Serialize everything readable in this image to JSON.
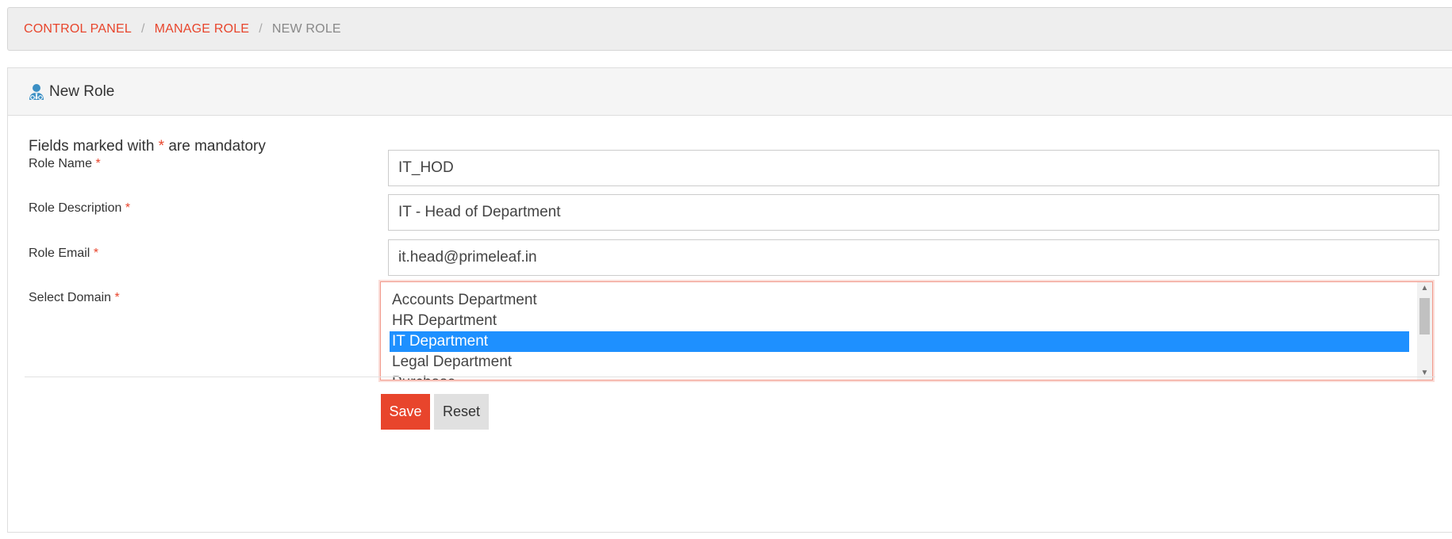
{
  "breadcrumb": {
    "items": [
      "CONTROL PANEL",
      "MANAGE ROLE"
    ],
    "separator": "/",
    "current": "NEW ROLE"
  },
  "panel": {
    "title": "New Role",
    "icon": "user-tie-icon"
  },
  "form": {
    "mandatory_prefix": "Fields marked with",
    "required_marker": "*",
    "mandatory_suffix": "are mandatory",
    "role_name": {
      "label": "Role Name",
      "value": "IT_HOD"
    },
    "role_description": {
      "label": "Role Description",
      "value": "IT - Head of Department"
    },
    "role_email": {
      "label": "Role Email",
      "value": "it.head@primeleaf.in"
    },
    "select_domain": {
      "label": "Select Domain",
      "options": [
        "Accounts Department",
        "HR Department",
        "IT Department",
        "Legal Department",
        "Purchase"
      ],
      "selected": "IT Department"
    }
  },
  "buttons": {
    "save": "Save",
    "reset": "Reset"
  },
  "colors": {
    "accent": "#e8452c",
    "selected_option": "#1e90ff",
    "breadcrumb_bg": "#eeeeee",
    "header_bg": "#f5f5f5"
  }
}
